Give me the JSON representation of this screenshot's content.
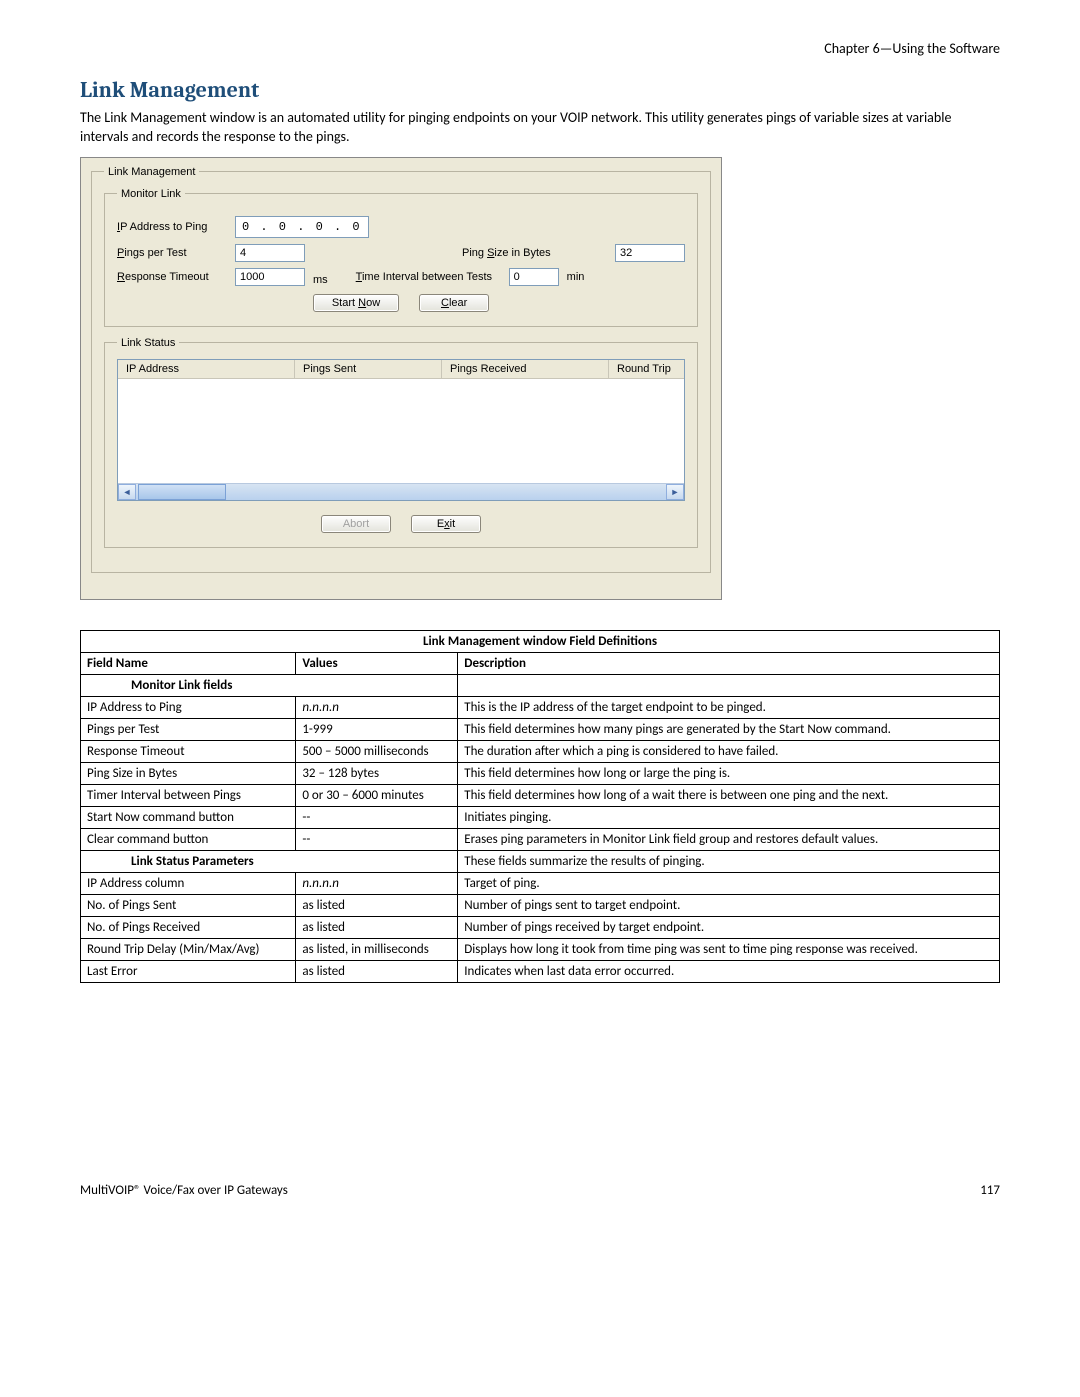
{
  "chapter": "Chapter 6—Using the Software",
  "heading": "Link Management",
  "intro": "The Link Management window is an automated utility for pinging endpoints on your VOIP network. This utility generates pings of variable sizes at variable intervals and records the response to the pings.",
  "dialog": {
    "groups": {
      "top": "Link Management",
      "monitor": "Monitor Link",
      "status": "Link Status"
    },
    "labels": {
      "ip_lead": "I",
      "ip_rest": "P Address to Ping",
      "ppt_lead": "P",
      "ppt_rest": "ings per Test",
      "rt_lead": "R",
      "rt_rest": "esponse Timeout",
      "ms": "ms",
      "ps_pre": "Ping ",
      "ps_lead": "S",
      "ps_rest": "ize in Bytes",
      "ti_lead": "T",
      "ti_rest": "ime Interval between Tests",
      "min": "min",
      "start_pre": "Start ",
      "start_lead": "N",
      "start_rest": "ow",
      "clear_lead": "C",
      "clear_rest": "lear",
      "abort": "Abort",
      "exit_pre": "E",
      "exit_lead": "x",
      "exit_rest": "it"
    },
    "values": {
      "ip": "0 . 0 . 0 . 0",
      "pings": "4",
      "timeout": "1000",
      "pingsize": "32",
      "interval": "0"
    },
    "cols": {
      "c1": "IP Address",
      "c2": "Pings Sent",
      "c3": "Pings Received",
      "c4": "Round Trip"
    }
  },
  "table": {
    "caption": "Link Management window Field Definitions",
    "head": {
      "c1": "Field Name",
      "c2": "Values",
      "c3": "Description"
    },
    "sub1": "Monitor Link fields",
    "rows1": [
      {
        "f": "IP Address to Ping",
        "v": "n.n.n.n",
        "vItal": true,
        "d": "This is the IP address of the target endpoint to be pinged."
      },
      {
        "f": "Pings per Test",
        "v": "1-999",
        "d": "This field determines how many pings are generated by the Start Now command."
      },
      {
        "f": "Response Timeout",
        "v": "500 – 5000 milliseconds",
        "d": "The duration after which a ping is considered to have failed."
      },
      {
        "f": "Ping Size in Bytes",
        "v": "32 – 128 bytes",
        "d": "This field determines how long or large the ping is."
      },
      {
        "f": "Timer Interval between Pings",
        "v": "0 or 30 – 6000 minutes",
        "d": "This field determines how long of a wait there is between one ping and the next."
      },
      {
        "f": "Start Now command button",
        "v": "--",
        "d": "Initiates pinging."
      },
      {
        "f": "Clear command button",
        "v": "--",
        "d": "Erases ping parameters in Monitor Link field group and restores default values."
      }
    ],
    "sub2": "Link Status Parameters",
    "sub2desc": "These fields summarize the results of pinging.",
    "rows2": [
      {
        "f": "IP Address column",
        "v": "n.n.n.n",
        "vItal": true,
        "d": "Target of ping."
      },
      {
        "f": "No. of Pings Sent",
        "v": "as listed",
        "d": "Number of pings sent to target endpoint."
      },
      {
        "f": "No. of Pings Received",
        "v": "as listed",
        "d": "Number of pings received by target endpoint."
      },
      {
        "f": "Round Trip Delay (Min/Max/Avg)",
        "v": "as listed, in milliseconds",
        "d": "Displays how long it took from time ping was sent to time ping response was received."
      },
      {
        "f": "Last Error",
        "v": "as listed",
        "d": "Indicates when last data error occurred."
      }
    ]
  },
  "footer": {
    "left": "MultiVOIP® Voice/Fax over IP Gateways",
    "right": "117"
  }
}
